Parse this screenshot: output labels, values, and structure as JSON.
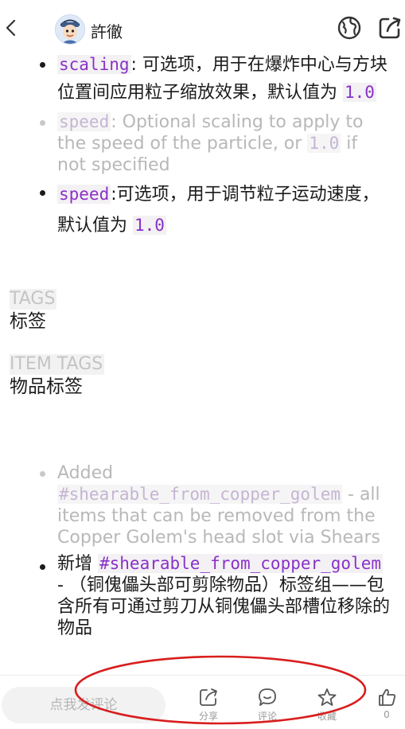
{
  "header": {
    "author": "許徹"
  },
  "content": {
    "particles": [
      {
        "lang": "zh",
        "code": "scaling",
        "text": ": 可选项，用于在爆炸中心与方块位置间应用粒子缩放效果，默认值为 ",
        "value": "1.0"
      },
      {
        "lang": "en",
        "code": "speed",
        "text": ": Optional scaling to apply to the speed of the particle, or ",
        "value": "1.0",
        "tail": " if not specified"
      },
      {
        "lang": "zh",
        "code": "speed",
        "text": ":可选项，用于调节粒子运动速度，默认值为 ",
        "value": "1.0"
      }
    ],
    "tags_en": "TAGS",
    "tags_zh": "标签",
    "item_tags_en": "ITEM TAGS",
    "item_tags_zh": "物品标签",
    "items": [
      {
        "lang": "en",
        "prefix": "Added ",
        "code": "#shearable_from_copper_golem",
        "text": " - all items that can be removed from the Copper Golem's head slot via Shears"
      },
      {
        "lang": "zh",
        "prefix": "新增 ",
        "code": "#shearable_from_copper_golem",
        "text": " - （铜傀儡头部可剪除物品）标签组——包含所有可通过剪刀从铜傀儡头部槽位移除的物品"
      }
    ]
  },
  "bottombar": {
    "comment_placeholder": "点我发评论",
    "share_label": "分享",
    "comment_label": "评论",
    "favorite_label": "收藏",
    "like_count": "0"
  },
  "colors": {
    "code_purple": "#8a31c9",
    "annotation_red": "#d81e1e"
  }
}
